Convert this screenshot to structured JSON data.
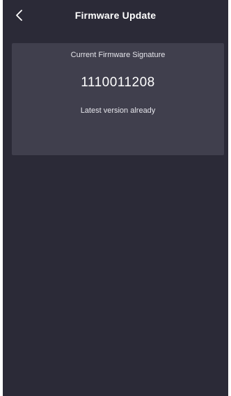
{
  "header": {
    "title": "Firmware Update",
    "back_icon": "chevron-left-icon"
  },
  "firmware": {
    "label": "Current Firmware Signature",
    "signature": "1110011208",
    "status": "Latest version already"
  },
  "colors": {
    "background": "#2b2a37",
    "card": "#403f4d",
    "text": "#ffffff"
  }
}
